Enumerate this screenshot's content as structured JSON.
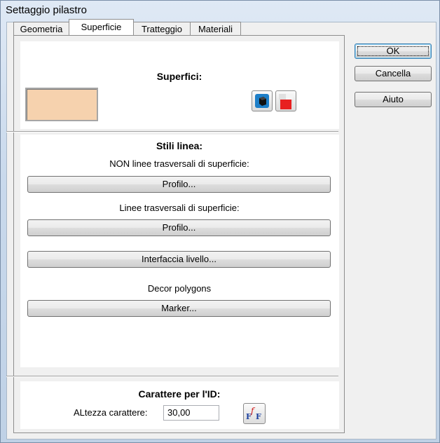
{
  "window": {
    "title": "Settaggio pilastro"
  },
  "tabs": [
    {
      "label": "Geometria"
    },
    {
      "label": "Superficie"
    },
    {
      "label": "Tratteggio"
    },
    {
      "label": "Materiali"
    }
  ],
  "buttons": {
    "ok": "OK",
    "cancel": "Cancella",
    "help": "Aiuto"
  },
  "surfaces": {
    "heading": "Superfici:",
    "swatch_color": "#f6d2ae",
    "icons": [
      "cube-icon",
      "fill-color-icon"
    ]
  },
  "line_styles": {
    "heading": "Stili linea:",
    "non_transversal_label": "NON linee trasversali di superficie:",
    "non_transversal_button": "Profilo...",
    "transversal_label": "Linee trasversali di superficie:",
    "transversal_button": "Profilo...",
    "interface_button": "Interfaccia livello...",
    "decor_label": "Decor polygons",
    "marker_button": "Marker..."
  },
  "id_font": {
    "heading": "Carattere per l'ID:",
    "height_label": "ALtezza carattere:",
    "height_value": "30,00",
    "font_icon": "font-icon"
  }
}
